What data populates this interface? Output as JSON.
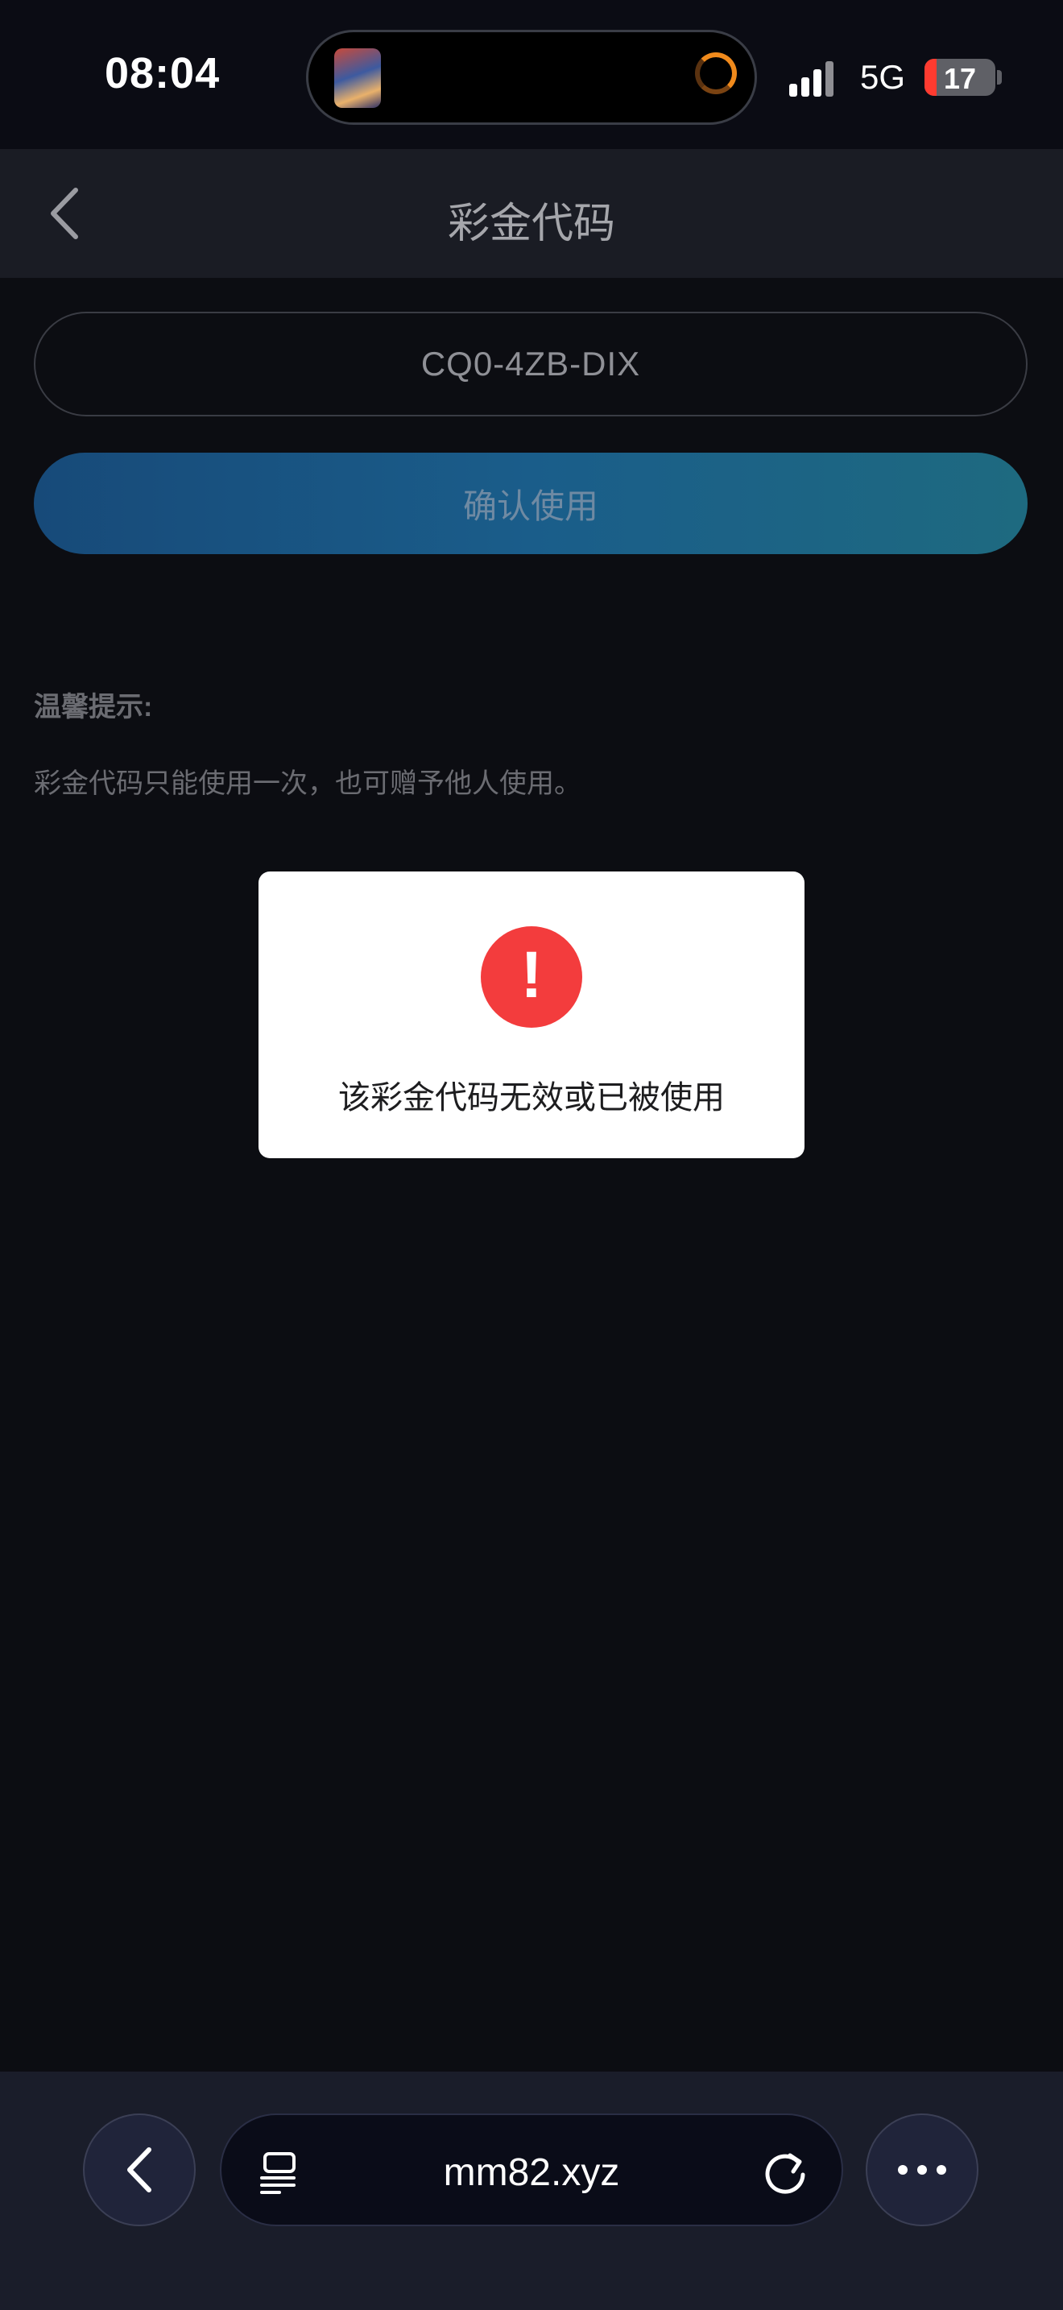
{
  "status_bar": {
    "time": "08:04",
    "network": "5G",
    "battery": "17",
    "battery_level": 0.17
  },
  "nav": {
    "title": "彩金代码"
  },
  "form": {
    "code_value": "CQ0-4ZB-DIX",
    "confirm_label": "确认使用"
  },
  "tips": {
    "title": "温馨提示:",
    "text": "彩金代码只能使用一次，也可赠予他人使用。"
  },
  "modal": {
    "icon": "!",
    "message": "该彩金代码无效或已被使用"
  },
  "browser": {
    "url": "mm82.xyz"
  },
  "colors": {
    "accent_blue": "#1a5d8a",
    "alert_red": "#f33c3d",
    "battery_red": "#ff3b30"
  }
}
